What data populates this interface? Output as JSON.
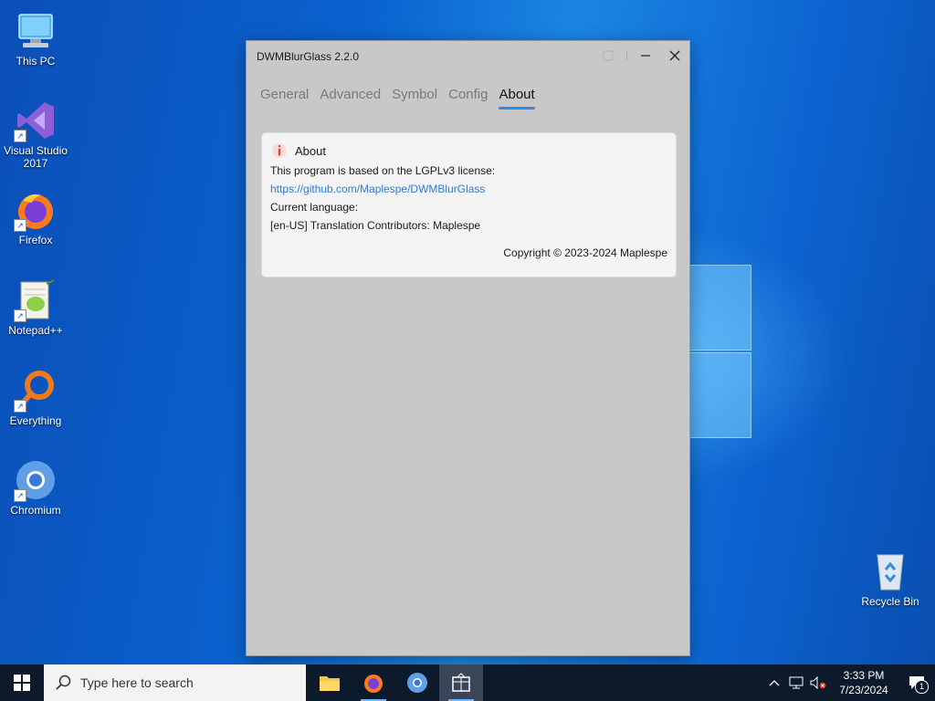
{
  "desktop": {
    "icons": [
      {
        "label": "This PC"
      },
      {
        "label": "Visual Studio 2017"
      },
      {
        "label": "Firefox"
      },
      {
        "label": "Notepad++"
      },
      {
        "label": "Everything"
      },
      {
        "label": "Chromium"
      },
      {
        "label": "Recycle Bin"
      }
    ]
  },
  "window": {
    "title": "DWMBlurGlass 2.2.0",
    "tabs": [
      {
        "label": "General"
      },
      {
        "label": "Advanced"
      },
      {
        "label": "Symbol"
      },
      {
        "label": "Config"
      },
      {
        "label": "About"
      }
    ],
    "active_tab": "About",
    "about": {
      "heading": "About",
      "license_text": "This program is based on the LGPLv3 license:",
      "link": "https://github.com/Maplespe/DWMBlurGlass",
      "language_label": "Current language:",
      "translation": "[en-US] Translation Contributors: Maplespe",
      "copyright": "Copyright © 2023-2024 Maplespe"
    }
  },
  "taskbar": {
    "search_placeholder": "Type here to search",
    "time": "3:33 PM",
    "date": "7/23/2024",
    "notification_count": "1"
  },
  "colors": {
    "accent": "#2b8ce3",
    "taskbar": "#0c1a2c",
    "window_bg": "#c8c8c8"
  }
}
